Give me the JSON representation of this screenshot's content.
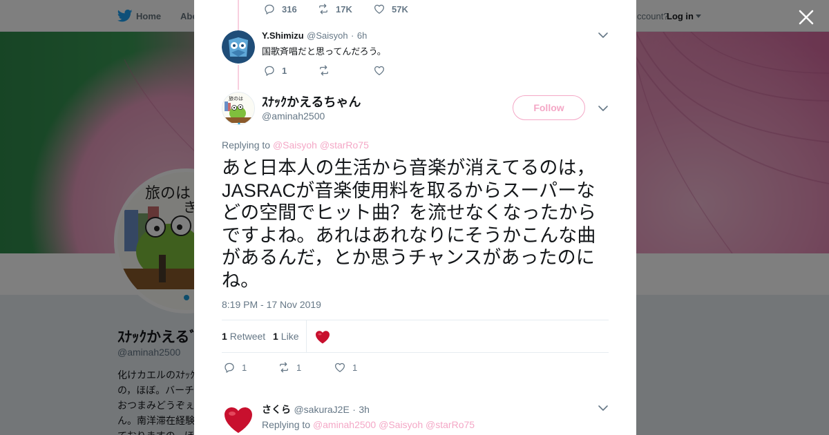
{
  "nav": {
    "home": "Home",
    "about": "Abo",
    "account_prompt": "ccount?",
    "login": "Log in"
  },
  "profile": {
    "name": "ｽﾅｯｸかえるﾞ",
    "handle": "@aminah2500",
    "bio_lines": [
      "化けカエルのｽﾅｯｸ",
      "の，ほぼ。バーチ",
      "おつまみどうぞぇ",
      "ん。南洋滞在経験",
      "ておりますの，ほ"
    ]
  },
  "prev_tweet_actions": {
    "replies": "316",
    "retweets": "17K",
    "likes": "57K"
  },
  "reply_tweet": {
    "name": "Y.Shimizu",
    "handle": "@Saisyoh",
    "dot": "·",
    "time": "6h",
    "text": "国歌斉唱だと思ってんだろう。",
    "replies": "1"
  },
  "main_tweet": {
    "name": "ｽﾅｯｸかえるちゃん",
    "handle": "@aminah2500",
    "follow_label": "Follow",
    "replying_label": "Replying to",
    "mention_1": "@Saisyoh",
    "mention_2": "@starRo75",
    "text": "あと日本人の生活から音楽が消えてるのは，JASRACが音楽使用料を取るからスーパーなどの空間でヒット曲？を流せなくなったからですよね。あれはあれなりにそうかこんな曲があるんだ，とか思うチャンスがあったのにね。",
    "timestamp": "8:19 PM - 17 Nov 2019",
    "retweet_count": "1",
    "retweet_label": "Retweet",
    "like_count": "1",
    "like_label": "Like",
    "replies": "1",
    "retweets": "1",
    "likes": "1"
  },
  "next_reply": {
    "name": "さくら",
    "handle": "@sakuraJ2E",
    "dot": "·",
    "time": "3h",
    "replying_label": "Replying to",
    "mention_1": "@aminah2500",
    "mention_2": "@Saisyoh",
    "mention_3": "@starRo75"
  },
  "colors": {
    "accent_pink": "#f4a7c6",
    "thread_line": "#f8cfdf",
    "text_primary": "#14171a",
    "text_secondary": "#657786",
    "heart_red": "#c8102e"
  },
  "icons": [
    "twitter-bird-icon",
    "close-icon",
    "reply-icon",
    "retweet-icon",
    "like-icon",
    "chevron-down-icon",
    "heart-avatar-icon"
  ]
}
